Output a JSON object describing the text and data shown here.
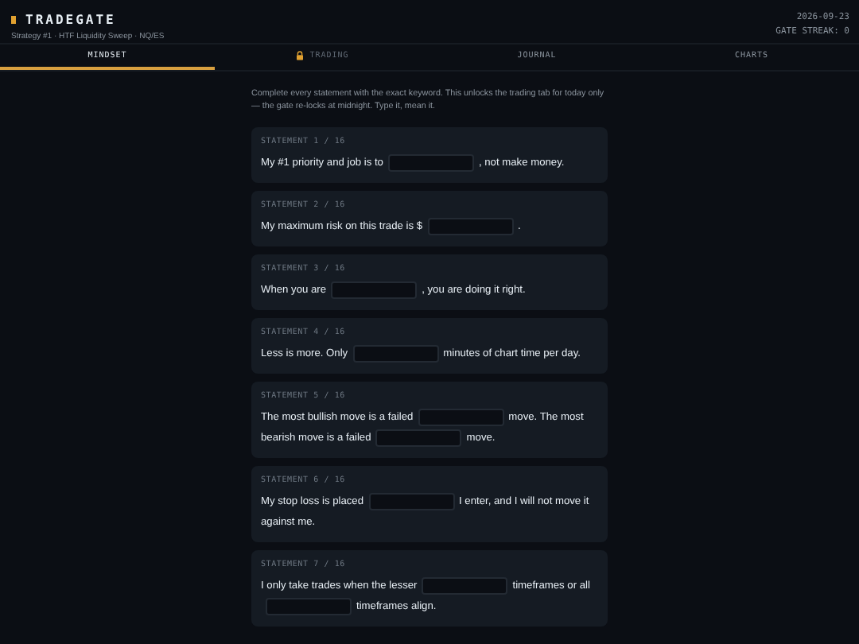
{
  "header": {
    "title": "TRADEGATE",
    "subtitle": "Strategy #1 · HTF Liquidity Sweep · NQ/ES",
    "date": "2026-09-23",
    "streak": "GATE STREAK: 0"
  },
  "tabs": [
    {
      "label": "MINDSET",
      "selected": true,
      "locked": false
    },
    {
      "label": "TRADING",
      "selected": false,
      "locked": true
    },
    {
      "label": "JOURNAL",
      "selected": false,
      "locked": false
    },
    {
      "label": "CHARTS",
      "selected": false,
      "locked": false
    }
  ],
  "intro": "Complete every statement with the exact keyword. This unlocks the trading tab for today only — the gate re-locks at midnight. Type it, mean it.",
  "statements": [
    {
      "label": "STATEMENT 1 / 16",
      "parts": [
        {
          "kind": "text",
          "text": "My #1 priority and job is to"
        },
        {
          "kind": "blank"
        },
        {
          "kind": "text",
          "text": ", not make money."
        }
      ]
    },
    {
      "label": "STATEMENT 2 / 16",
      "parts": [
        {
          "kind": "text",
          "text": "My maximum risk on this trade is $"
        },
        {
          "kind": "blank"
        },
        {
          "kind": "text",
          "text": "."
        }
      ]
    },
    {
      "label": "STATEMENT 3 / 16",
      "parts": [
        {
          "kind": "text",
          "text": "When you are"
        },
        {
          "kind": "blank"
        },
        {
          "kind": "text",
          "text": ", you are doing it right."
        }
      ]
    },
    {
      "label": "STATEMENT 4 / 16",
      "parts": [
        {
          "kind": "text",
          "text": "Less is more. Only"
        },
        {
          "kind": "blank"
        },
        {
          "kind": "text",
          "text": "minutes of chart time per day."
        }
      ]
    },
    {
      "label": "STATEMENT 5 / 16",
      "parts": [
        {
          "kind": "text",
          "text": "The most bullish move is a failed"
        },
        {
          "kind": "blank"
        },
        {
          "kind": "text",
          "text": "move. The most bearish move is a failed"
        },
        {
          "kind": "blank"
        },
        {
          "kind": "text",
          "text": "move."
        }
      ]
    },
    {
      "label": "STATEMENT 6 / 16",
      "parts": [
        {
          "kind": "text",
          "text": "My stop loss is placed"
        },
        {
          "kind": "blank"
        },
        {
          "kind": "text",
          "text": "I enter, and I will not move it against me."
        }
      ]
    },
    {
      "label": "STATEMENT 7 / 16",
      "parts": [
        {
          "kind": "text",
          "text": "I only take trades when the lesser"
        },
        {
          "kind": "blank"
        },
        {
          "kind": "text",
          "text": "timeframes or all"
        },
        {
          "kind": "blank"
        },
        {
          "kind": "text",
          "text": "timeframes align."
        }
      ]
    }
  ]
}
